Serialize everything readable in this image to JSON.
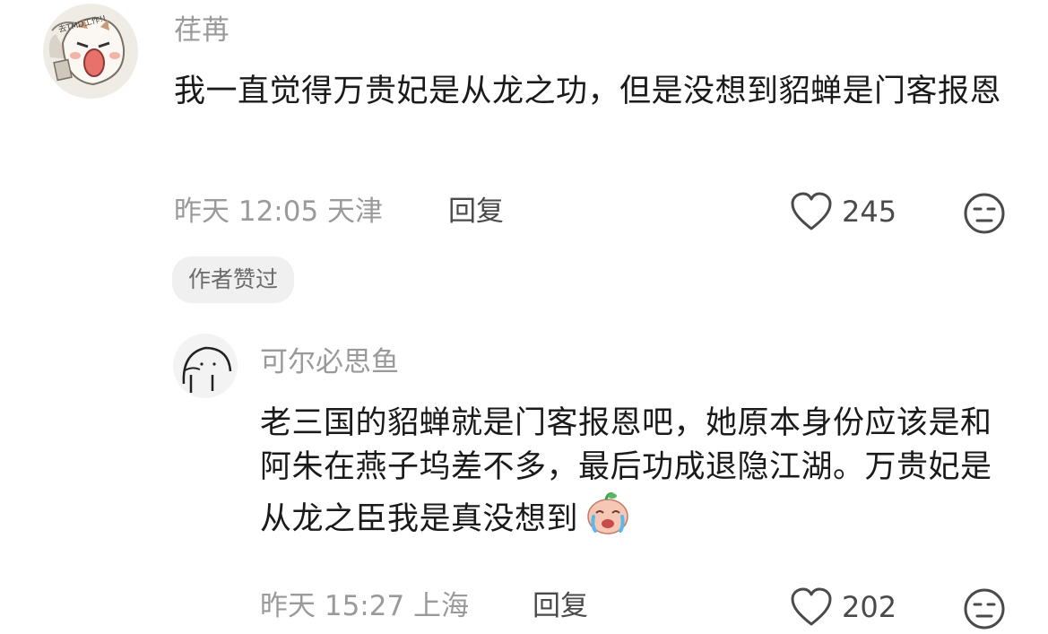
{
  "comments": [
    {
      "username": "荏苒",
      "content": "我一直觉得万贵妃是从龙之功，但是没想到貂蝉是门客报恩",
      "meta": "昨天 12:05 天津",
      "reply_label": "回复",
      "like_count": "245",
      "author_badge": "作者赞过",
      "avatar_text": "去TMD工作!!",
      "icons": [
        "heart-icon",
        "neutral-face-icon"
      ]
    },
    {
      "username": "可尔必思鱼",
      "content": "老三国的貂蝉就是门客报恩吧，她原本身份应该是和阿朱在燕子坞差不多，最后功成退隐江湖。万贵妃是从龙之臣我是真没想到",
      "meta": "昨天 15:27 上海",
      "reply_label": "回复",
      "like_count": "202",
      "icons": [
        "crying-emoji-icon",
        "heart-icon",
        "neutral-face-icon"
      ]
    }
  ],
  "colors": {
    "secondary_text": "#9a9a9a",
    "primary_text": "#1a1a1a",
    "badge_bg": "#f0f0f0"
  }
}
